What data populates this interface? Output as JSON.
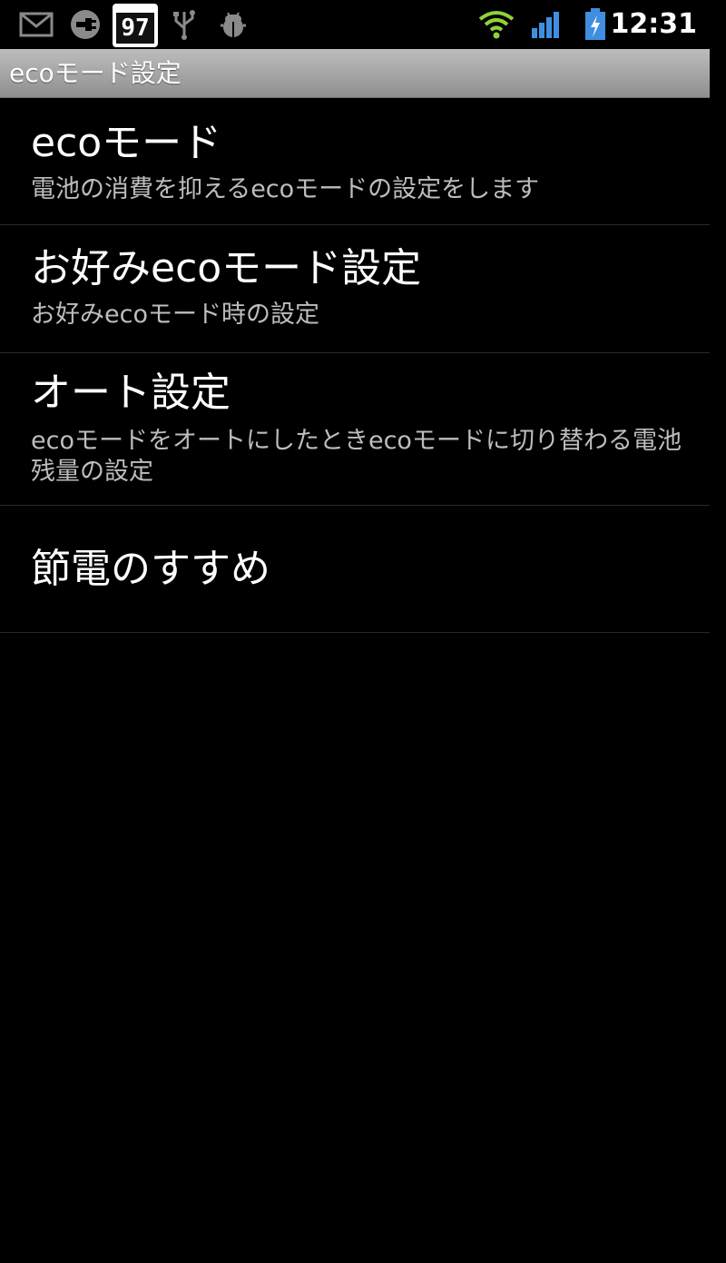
{
  "status_bar": {
    "icons_left": [
      "gmail-icon",
      "usb-plug-icon",
      "calendar-icon",
      "usb-icon",
      "android-debug-icon"
    ],
    "calendar_day": "97",
    "icons_right": [
      "wifi-icon",
      "signal-icon",
      "battery-charging-icon"
    ],
    "time": "12:31",
    "colors": {
      "wifi": "#8fd13b",
      "signal": "#3f8fe0",
      "battery": "#3f8fe0"
    }
  },
  "title_bar": {
    "title": "ecoモード設定"
  },
  "preferences": [
    {
      "title": "ecoモード",
      "summary": "電池の消費を抑えるecoモードの設定をします"
    },
    {
      "title": "お好みecoモード設定",
      "summary": "お好みecoモード時の設定"
    },
    {
      "title": "オート設定",
      "summary": "ecoモードをオートにしたときecoモードに切り替わる電池残量の設定"
    },
    {
      "title": "節電のすすめ",
      "summary": ""
    }
  ]
}
